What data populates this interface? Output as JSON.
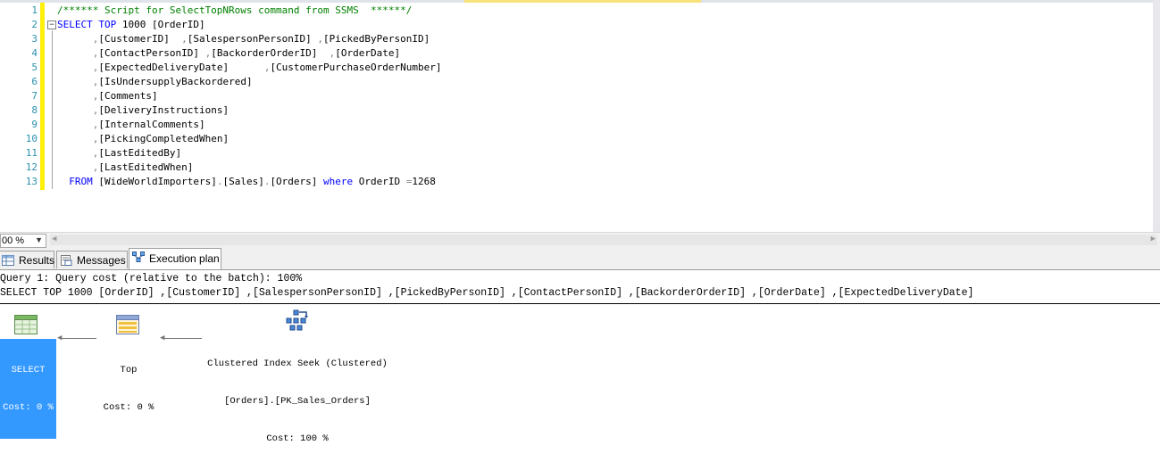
{
  "editor": {
    "line_numbers": [
      "1",
      "2",
      "3",
      "4",
      "5",
      "6",
      "7",
      "8",
      "9",
      "10",
      "11",
      "12",
      "13"
    ],
    "lines": [
      {
        "segments": [
          {
            "t": "/****** Script for SelectTopNRows command from SSMS  ******/",
            "c": "cm"
          }
        ]
      },
      {
        "segments": [
          {
            "t": "SELECT",
            "c": "kw"
          },
          {
            "t": " "
          },
          {
            "t": "TOP",
            "c": "kw"
          },
          {
            "t": " 1000 [OrderID]"
          }
        ]
      },
      {
        "segments": [
          {
            "t": "      "
          },
          {
            "t": ",",
            "c": "gy"
          },
          {
            "t": "[CustomerID]  "
          },
          {
            "t": ",",
            "c": "gy"
          },
          {
            "t": "[SalespersonPersonID] "
          },
          {
            "t": ",",
            "c": "gy"
          },
          {
            "t": "[PickedByPersonID]"
          }
        ]
      },
      {
        "segments": [
          {
            "t": "      "
          },
          {
            "t": ",",
            "c": "gy"
          },
          {
            "t": "[ContactPersonID] "
          },
          {
            "t": ",",
            "c": "gy"
          },
          {
            "t": "[BackorderOrderID]  "
          },
          {
            "t": ",",
            "c": "gy"
          },
          {
            "t": "[OrderDate]"
          }
        ]
      },
      {
        "segments": [
          {
            "t": "      "
          },
          {
            "t": ",",
            "c": "gy"
          },
          {
            "t": "[ExpectedDeliveryDate]      "
          },
          {
            "t": ",",
            "c": "gy"
          },
          {
            "t": "[CustomerPurchaseOrderNumber]"
          }
        ]
      },
      {
        "segments": [
          {
            "t": "      "
          },
          {
            "t": ",",
            "c": "gy"
          },
          {
            "t": "[IsUndersupplyBackordered]"
          }
        ]
      },
      {
        "segments": [
          {
            "t": "      "
          },
          {
            "t": ",",
            "c": "gy"
          },
          {
            "t": "[Comments]"
          }
        ]
      },
      {
        "segments": [
          {
            "t": "      "
          },
          {
            "t": ",",
            "c": "gy"
          },
          {
            "t": "[DeliveryInstructions]"
          }
        ]
      },
      {
        "segments": [
          {
            "t": "      "
          },
          {
            "t": ",",
            "c": "gy"
          },
          {
            "t": "[InternalComments]"
          }
        ]
      },
      {
        "segments": [
          {
            "t": "      "
          },
          {
            "t": ",",
            "c": "gy"
          },
          {
            "t": "[PickingCompletedWhen]"
          }
        ]
      },
      {
        "segments": [
          {
            "t": "      "
          },
          {
            "t": ",",
            "c": "gy"
          },
          {
            "t": "[LastEditedBy]"
          }
        ]
      },
      {
        "segments": [
          {
            "t": "      "
          },
          {
            "t": ",",
            "c": "gy"
          },
          {
            "t": "[LastEditedWhen]"
          }
        ]
      },
      {
        "segments": [
          {
            "t": "  "
          },
          {
            "t": "FROM",
            "c": "kw"
          },
          {
            "t": " [WideWorldImporters]"
          },
          {
            "t": ".",
            "c": "gy"
          },
          {
            "t": "[Sales]"
          },
          {
            "t": ".",
            "c": "gy"
          },
          {
            "t": "[Orders] "
          },
          {
            "t": "where",
            "c": "kw"
          },
          {
            "t": " OrderID "
          },
          {
            "t": "=",
            "c": "gy"
          },
          {
            "t": "1268"
          }
        ]
      }
    ]
  },
  "zoom": {
    "value": "00 %"
  },
  "tabs": [
    {
      "label": "Results",
      "icon": "results-grid-icon"
    },
    {
      "label": "Messages",
      "icon": "messages-icon"
    },
    {
      "label": "Execution plan",
      "icon": "execution-plan-icon"
    }
  ],
  "plan": {
    "query_header": "Query 1: Query cost (relative to the batch): 100%",
    "query_text": "SELECT TOP 1000 [OrderID] ,[CustomerID] ,[SalespersonPersonID] ,[PickedByPersonID] ,[ContactPersonID] ,[BackorderOrderID] ,[OrderDate] ,[ExpectedDeliveryDate]",
    "nodes": {
      "select": {
        "name": "SELECT",
        "cost": "Cost: 0 %",
        "icon": "select-operator-icon"
      },
      "top": {
        "name": "Top",
        "cost": "Cost: 0 %",
        "icon": "top-operator-icon"
      },
      "seek": {
        "name": "Clustered Index Seek (Clustered)",
        "object": "[Orders].[PK_Sales_Orders]",
        "cost": "Cost: 100 %",
        "icon": "clustered-index-seek-icon"
      }
    }
  },
  "colors": {
    "keyword": "#0000ff",
    "comment": "#008000",
    "line_number": "#2b91af",
    "selected_node": "#3399ff"
  }
}
